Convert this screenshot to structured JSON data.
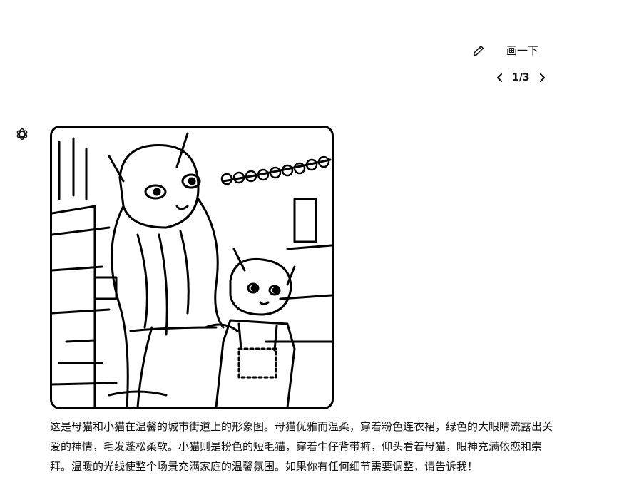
{
  "user_message": {
    "text": "画一下"
  },
  "pager": {
    "label": "1/3"
  },
  "assistant": {
    "image_alt": "母猫和小猫在温馨的城市街道上的形象图",
    "reply": "这是母猫和小猫在温馨的城市街道上的形象图。母猫优雅而温柔，穿着粉色连衣裙，绿色的大眼睛流露出关爱的神情，毛发蓬松柔软。小猫则是粉色的短毛猫，穿着牛仔背带裤，仰头看着母猫，眼神充满依恋和崇拜。温暖的光线使整个场景充满家庭的温馨氛围。如果你有任何细节需要调整，请告诉我！"
  },
  "icons": {
    "edit": "pencil-icon",
    "prev": "chevron-left-icon",
    "next": "chevron-right-icon",
    "avatar": "openai-logo-icon"
  }
}
